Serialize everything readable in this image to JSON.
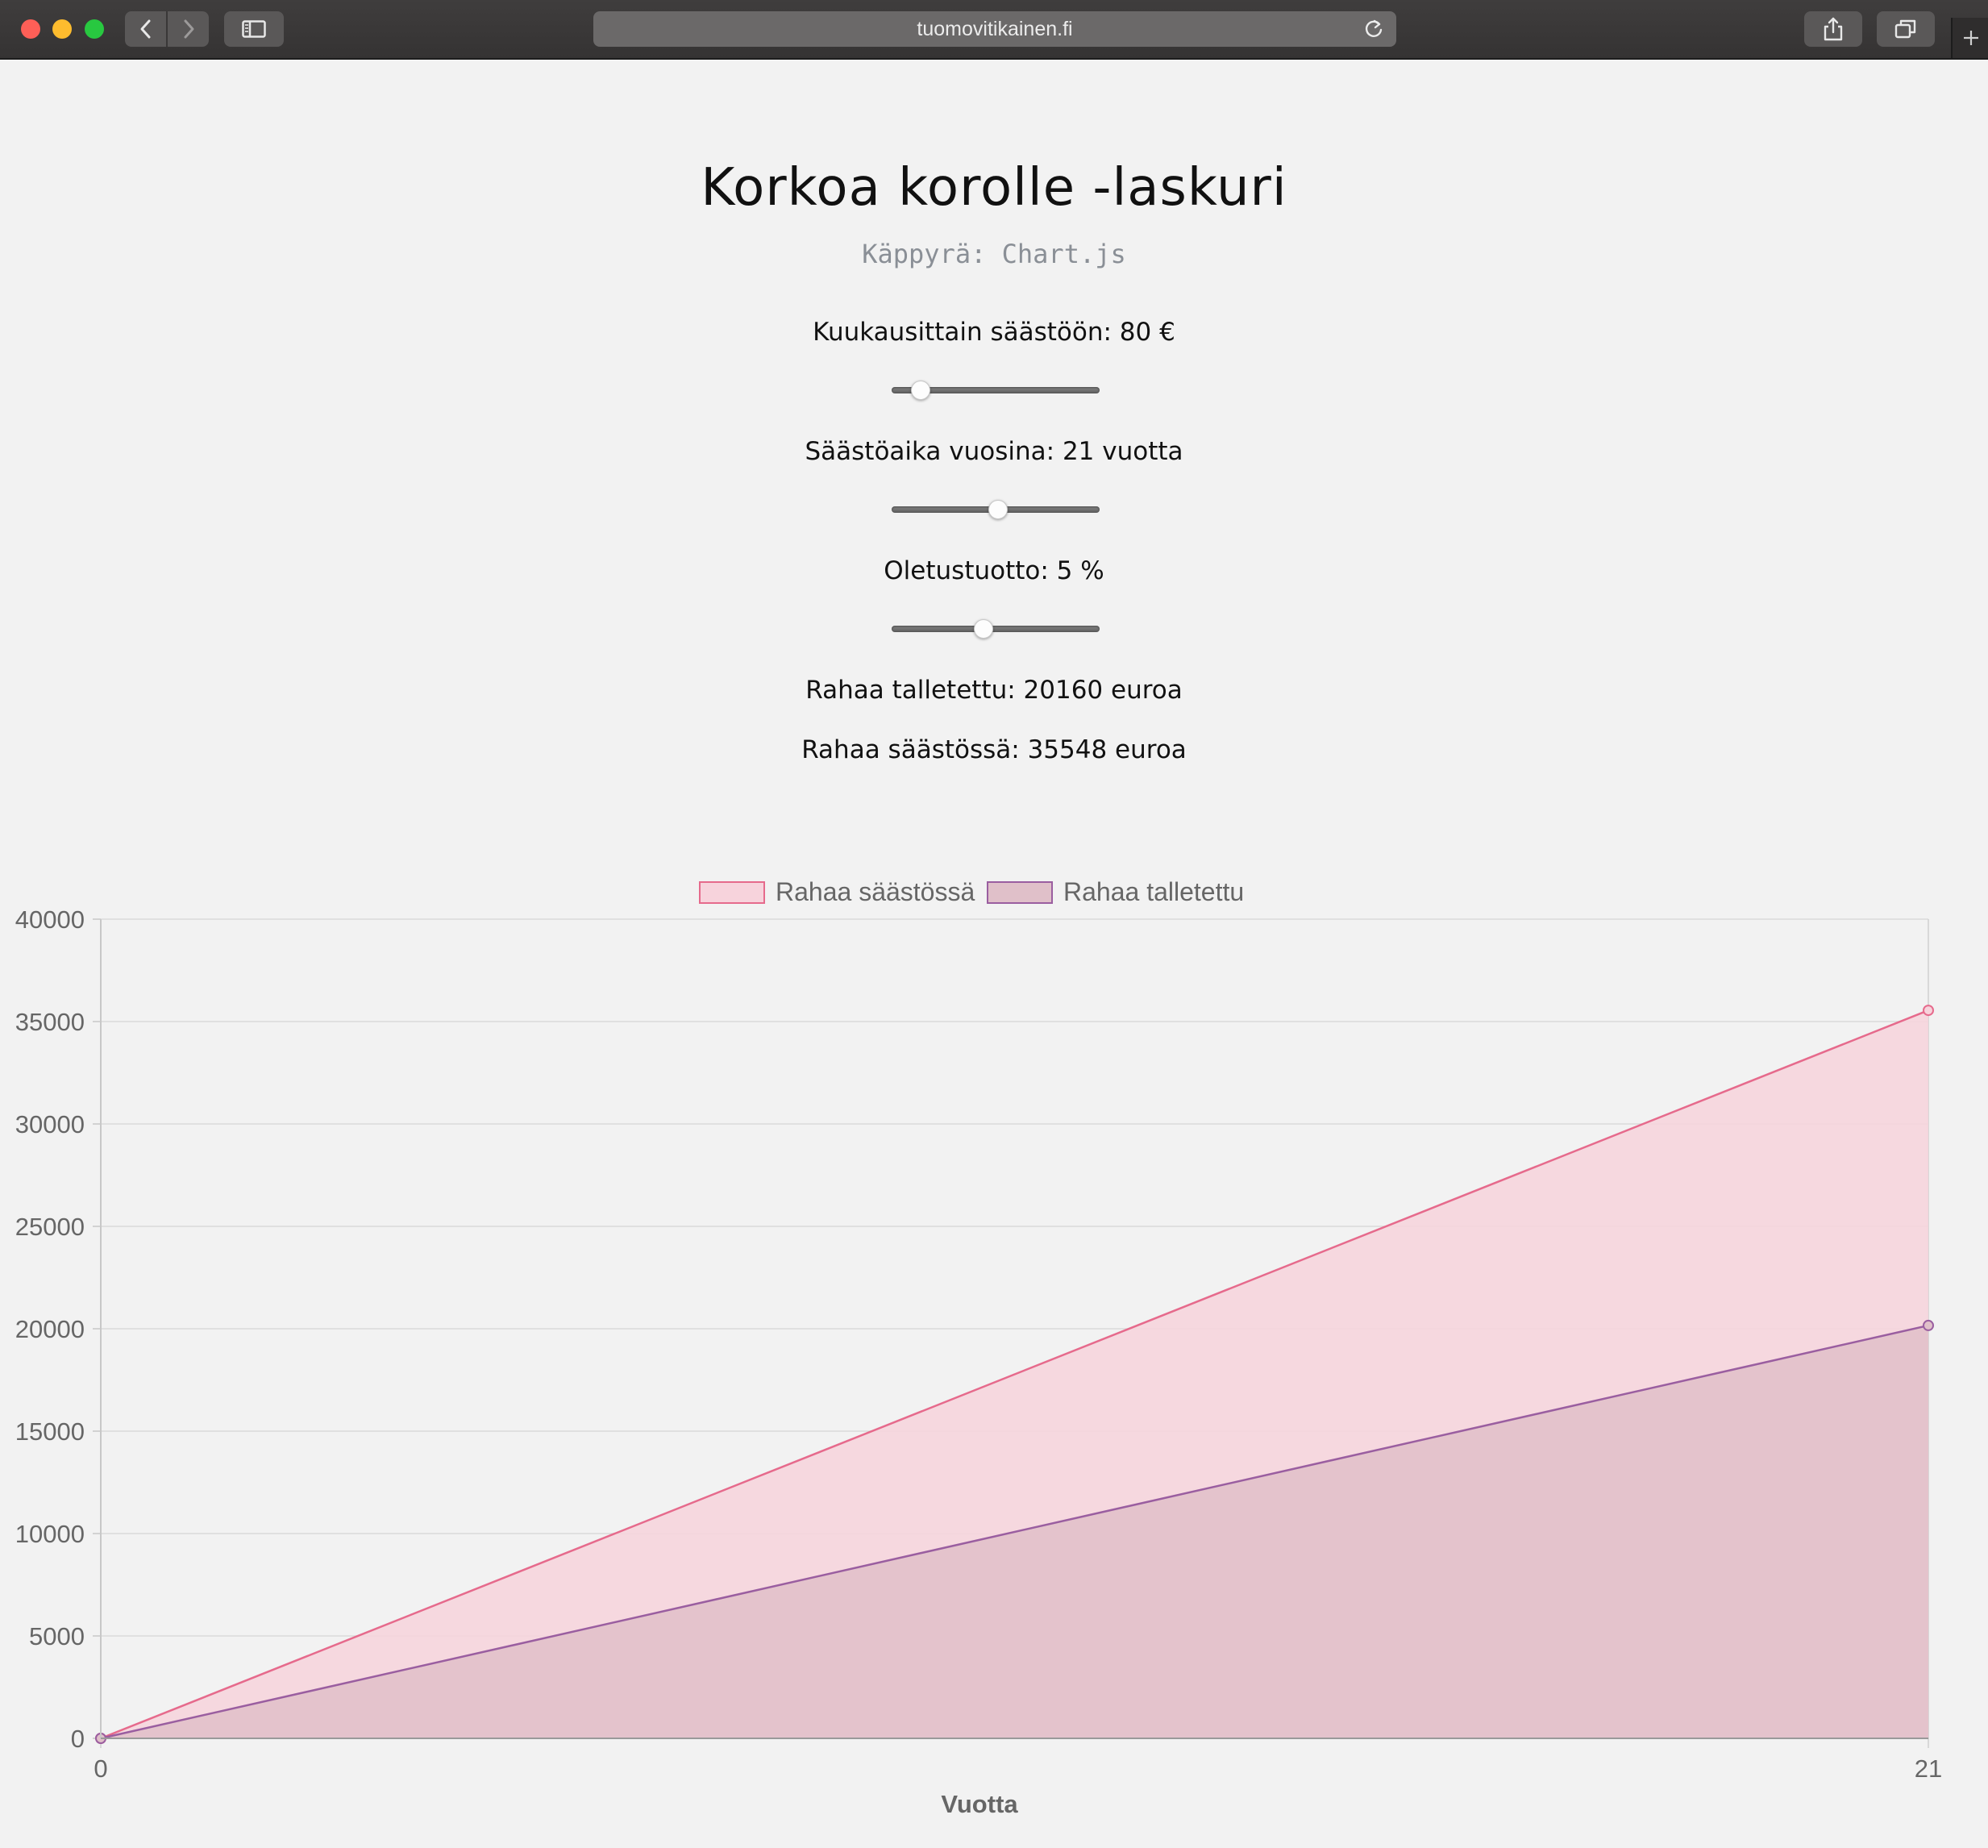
{
  "browser": {
    "url": "tuomovitikainen.fi"
  },
  "page": {
    "title": "Korkoa korolle -laskuri",
    "subtitle": "Käppyrä: Chart.js",
    "monthly_label": "Kuukausittain säästöön: 80 €",
    "years_label": "Säästöaika vuosina: 21 vuotta",
    "return_label": "Oletustuotto: 5 %",
    "deposited_text": "Rahaa talletettu: 20160 euroa",
    "saved_text": "Rahaa säästössä: 35548 euroa"
  },
  "sliders": {
    "monthly": {
      "value": 0.14
    },
    "years": {
      "value": 0.51
    },
    "return": {
      "value": 0.44
    }
  },
  "chart_data": {
    "type": "area",
    "x": [
      0,
      21
    ],
    "xlabel": "Vuotta",
    "ylabel": "",
    "ylim": [
      0,
      40000
    ],
    "yticks": [
      0,
      5000,
      10000,
      15000,
      20000,
      25000,
      30000,
      35000,
      40000
    ],
    "xticks": [
      "0",
      "21"
    ],
    "legend_position": "top",
    "grid": true,
    "series": [
      {
        "name": "Rahaa säästössä",
        "values": [
          0,
          35548
        ],
        "line_color": "#e66a8c",
        "fill_color": "#f7d3dc"
      },
      {
        "name": "Rahaa talletettu",
        "values": [
          0,
          20160
        ],
        "line_color": "#9a5ea0",
        "fill_color": "#e0c0c9"
      }
    ]
  }
}
